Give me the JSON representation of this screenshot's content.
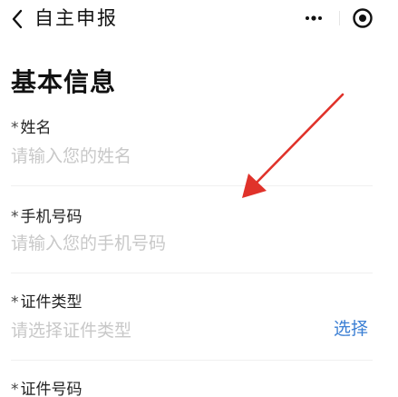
{
  "nav": {
    "title": "自主申报",
    "back_icon": "chevron-left-icon",
    "more_icon": "more-dots-icon",
    "close_icon": "target-circle-icon"
  },
  "section": {
    "title": "基本信息"
  },
  "form": {
    "required_mark": "*",
    "fields": [
      {
        "label": "姓名",
        "placeholder": "请输入您的姓名"
      },
      {
        "label": "手机号码",
        "placeholder": "请输入您的手机号码"
      },
      {
        "label": "证件类型",
        "placeholder": "请选择证件类型",
        "action_label": "选择"
      },
      {
        "label": "证件号码"
      }
    ]
  },
  "annotation": {
    "icon": "red-arrow-icon",
    "color": "#e0322a"
  },
  "colors": {
    "link": "#3b7fd4",
    "placeholder": "#c8c8c8"
  }
}
